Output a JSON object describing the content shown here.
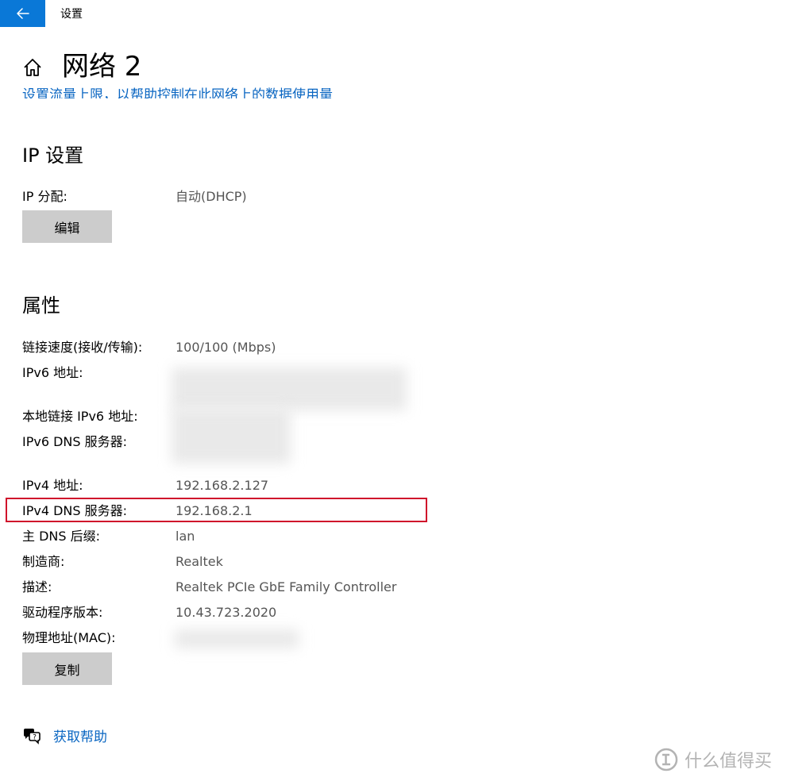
{
  "window": {
    "title": "设置"
  },
  "header": {
    "page_title": "网络 2",
    "clipped_link_text": "设置流量上限，以帮助控制在此网络上的数据使用量"
  },
  "ip_settings": {
    "heading": "IP 设置",
    "assignment_label": "IP 分配:",
    "assignment_value": "自动(DHCP)",
    "edit_button": "编辑"
  },
  "properties": {
    "heading": "属性",
    "link_speed_label": "链接速度(接收/传输):",
    "link_speed_value": "100/100 (Mbps)",
    "ipv6_address_label": "IPv6 地址:",
    "link_local_ipv6_label": "本地链接 IPv6 地址:",
    "ipv6_dns_label": "IPv6 DNS 服务器:",
    "ipv4_address_label": "IPv4 地址:",
    "ipv4_address_value": "192.168.2.127",
    "ipv4_dns_label": "IPv4 DNS 服务器:",
    "ipv4_dns_value": "192.168.2.1",
    "dns_suffix_label": "主 DNS 后缀:",
    "dns_suffix_value": "lan",
    "manufacturer_label": "制造商:",
    "manufacturer_value": "Realtek",
    "description_label": "描述:",
    "description_value": "Realtek PCIe GbE Family Controller",
    "driver_version_label": "驱动程序版本:",
    "driver_version_value": "10.43.723.2020",
    "mac_label": "物理地址(MAC):",
    "copy_button": "复制"
  },
  "footer": {
    "help_link": "获取帮助"
  },
  "watermark": {
    "text": "什么值得买"
  },
  "colors": {
    "accent": "#0a78d7",
    "link": "#0a66c2",
    "highlight": "#d0112b",
    "button_bg": "#cccccc"
  }
}
